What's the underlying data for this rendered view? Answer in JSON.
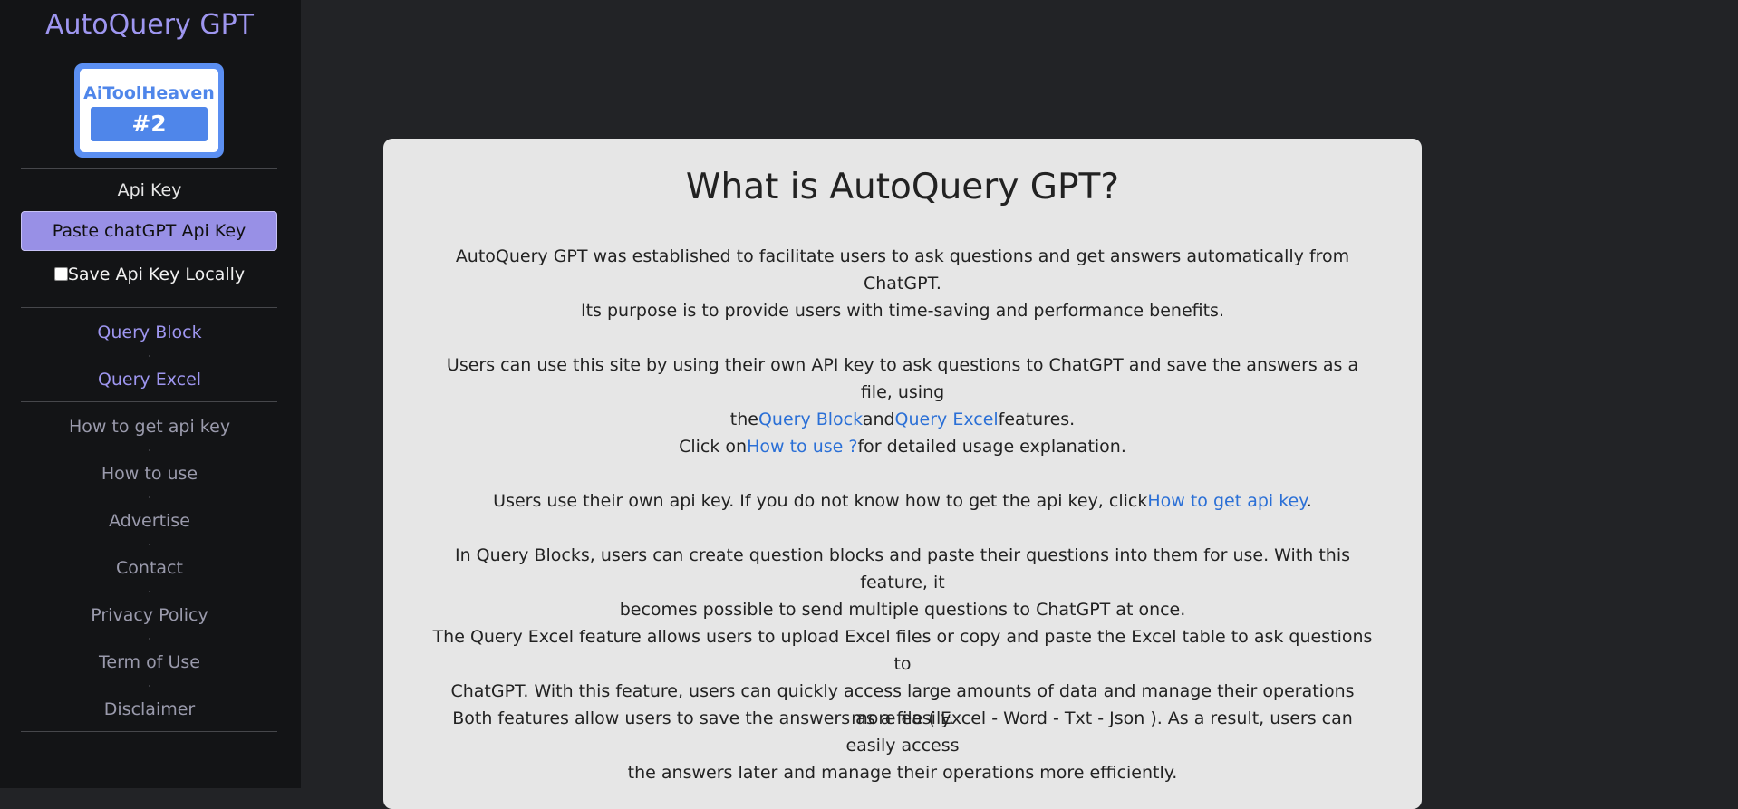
{
  "sidebar": {
    "app_title": "AutoQuery GPT",
    "badge": {
      "name": "AiToolHeaven",
      "rank": "#2"
    },
    "api_label": "Api Key",
    "api_button": "Paste chatGPT Api Key",
    "save_label": "Save Api Key Locally",
    "nav_primary": [
      "Query Block",
      "Query Excel"
    ],
    "nav_secondary": [
      "How to get api key",
      "How to use",
      "Advertise",
      "Contact",
      "Privacy Policy",
      "Term of Use",
      "Disclaimer"
    ]
  },
  "main": {
    "heading": "What is AutoQuery GPT?",
    "p1": "AutoQuery GPT was established to facilitate users to ask questions and get answers automatically from ChatGPT.",
    "p2": "Its purpose is to provide users with time-saving and performance benefits.",
    "p3_line1": "Users can use this site by using their own API key to ask questions to ChatGPT and save the answers as a file, using",
    "p3_the": "the",
    "p3_link1": "Query Block",
    "p3_and": "and",
    "p3_link2": "Query Excel",
    "p3_end": "features.",
    "p4_start": "Click on",
    "p4_link": "How to use ?",
    "p4_end": "for detailed usage explanation.",
    "p5_start": "Users use their own api key. If you do not know how to get the api key, click",
    "p5_link": "How to get api key",
    "p5_end": ".",
    "p6_line1": "In Query Blocks, users can create question blocks and paste their questions into them for use. With this feature, it",
    "p6_line2": "becomes possible to send multiple questions to ChatGPT at once.",
    "p7_line1": "The Query Excel feature allows users to upload Excel files or copy and paste the Excel table to ask questions to",
    "p7_line2": "ChatGPT. With this feature, users can quickly access large amounts of data and manage their operations more easily.",
    "p8_line1": "Both features allow users to save the answers as a file ( Excel - Word - Txt - Json ). As a result, users can easily access",
    "p8_line2": "the answers later and manage their operations more efficiently."
  },
  "colors": {
    "sidebar_bg": "#131416",
    "page_bg": "#222326",
    "accent_purple": "#9e96f0",
    "button_bg": "#9890e6",
    "link_blue": "#2a6fd6",
    "badge_blue": "#4f86ea",
    "card_bg": "#e6e6e6"
  }
}
